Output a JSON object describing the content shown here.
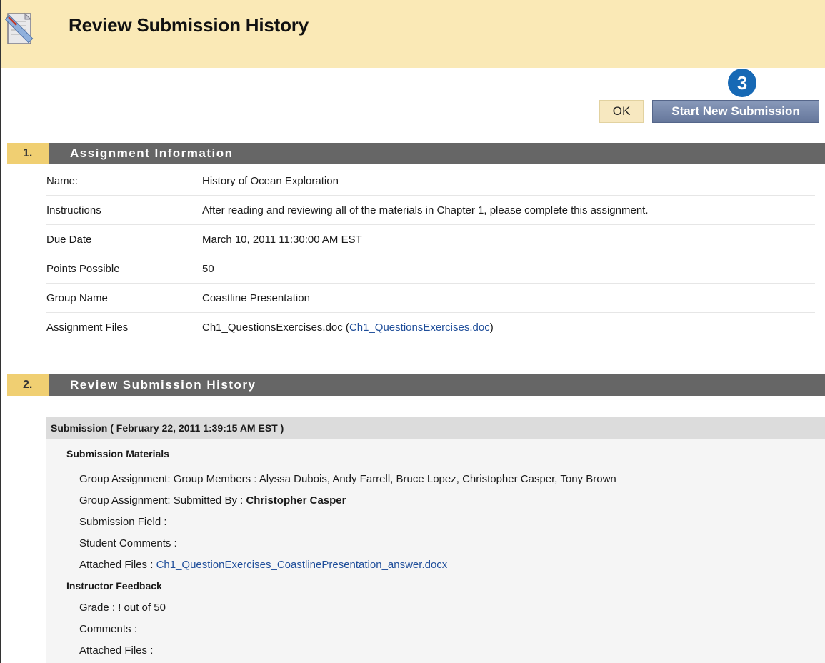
{
  "header": {
    "title": "Review Submission History",
    "icon": "assignment-ruler-icon"
  },
  "step_badge": "3",
  "buttons": {
    "ok": "OK",
    "start_new": "Start New Submission"
  },
  "sections": [
    {
      "number": "1.",
      "title": "Assignment Information"
    },
    {
      "number": "2.",
      "title": "Review Submission History"
    }
  ],
  "assignment": {
    "rows": [
      {
        "label": "Name:",
        "value": "History of Ocean Exploration"
      },
      {
        "label": "Instructions",
        "value": "After reading and reviewing all of the materials in Chapter 1, please complete this assignment."
      },
      {
        "label": "Due Date",
        "value": "March 10, 2011 11:30:00 AM EST"
      },
      {
        "label": "Points Possible",
        "value": "50"
      },
      {
        "label": "Group Name",
        "value": "Coastline Presentation"
      },
      {
        "label": "Assignment Files",
        "value": "Ch1_QuestionsExercises.doc (",
        "link": "Ch1_QuestionsExercises.doc",
        "suffix": ")"
      }
    ]
  },
  "submission": {
    "heading": "Submission ( February 22, 2011 1:39:15 AM EST )",
    "materials_heading": "Submission Materials",
    "group_members_label": "Group Assignment: Group Members : ",
    "group_members_value": "Alyssa Dubois, Andy Farrell, Bruce Lopez, Christopher Casper, Tony Brown",
    "submitted_by_label": "Group Assignment: Submitted By : ",
    "submitted_by_value": "Christopher Casper",
    "submission_field": "Submission Field :",
    "student_comments": "Student Comments :",
    "attached_files_label": "Attached Files : ",
    "attached_files_link": "Ch1_QuestionExercises_CoastlinePresentation_answer.docx",
    "feedback_heading": "Instructor Feedback",
    "grade": "Grade : ! out of 50",
    "comments": "Comments :",
    "feedback_attached": "Attached Files :"
  }
}
